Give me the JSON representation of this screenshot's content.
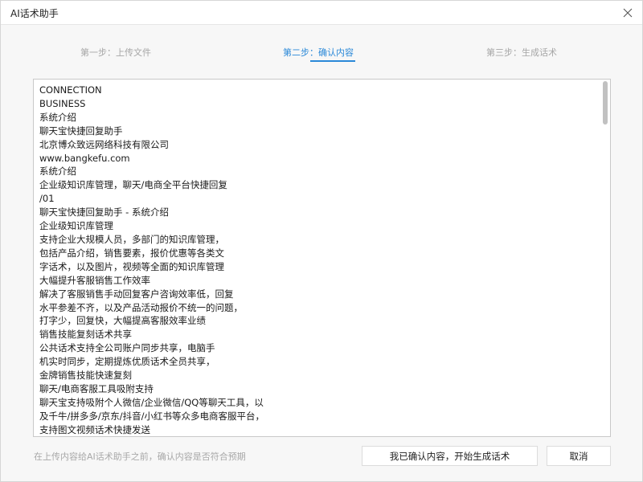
{
  "window": {
    "title": "AI话术助手"
  },
  "steps": [
    {
      "label": "第一步：上传文件",
      "state": "done"
    },
    {
      "label": "第二步：确认内容",
      "state": "active"
    },
    {
      "label": "第三步：生成话术",
      "state": "pending"
    }
  ],
  "content": {
    "lines": [
      "CONNECTION",
      "BUSINESS",
      "系统介绍",
      "聊天宝快捷回复助手",
      "北京博众致远网络科技有限公司",
      "www.bangkefu.com",
      "系统介绍",
      "企业级知识库管理，聊天/电商全平台快捷回复",
      "/01",
      "聊天宝快捷回复助手 - 系统介绍",
      "企业级知识库管理",
      "支持企业大规模人员，多部门的知识库管理，",
      "包括产品介绍，销售要素，报价优惠等各类文",
      "字话术，以及图片，视频等全面的知识库管理",
      "大幅提升客服销售工作效率",
      "解决了客服销售手动回复客户咨询效率低，回复",
      "水平参差不齐，以及产品活动报价不统一的问题，",
      "打字少，回复快，大幅提高客服效率业绩",
      "销售技能复刻话术共享",
      "公共话术支持全公司账户同步共享，电脑手",
      "机实时同步，定期提炼优质话术全员共享，",
      "金牌销售技能快速复刻",
      "聊天/电商客服工具吸附支持",
      "聊天宝支持吸附个人微信/企业微信/QQ等聊天工具，以",
      "及千牛/拼多多/京东/抖音/小红书等众多电商客服平台，",
      "支持图文视频话术快捷发送"
    ]
  },
  "footer": {
    "hint": "在上传内容给AI话术助手之前，确认内容是否符合预期",
    "confirm_label": "我已确认内容，开始生成话术",
    "cancel_label": "取消"
  },
  "colors": {
    "accent": "#2b89d8",
    "muted": "#a6a6a6"
  }
}
